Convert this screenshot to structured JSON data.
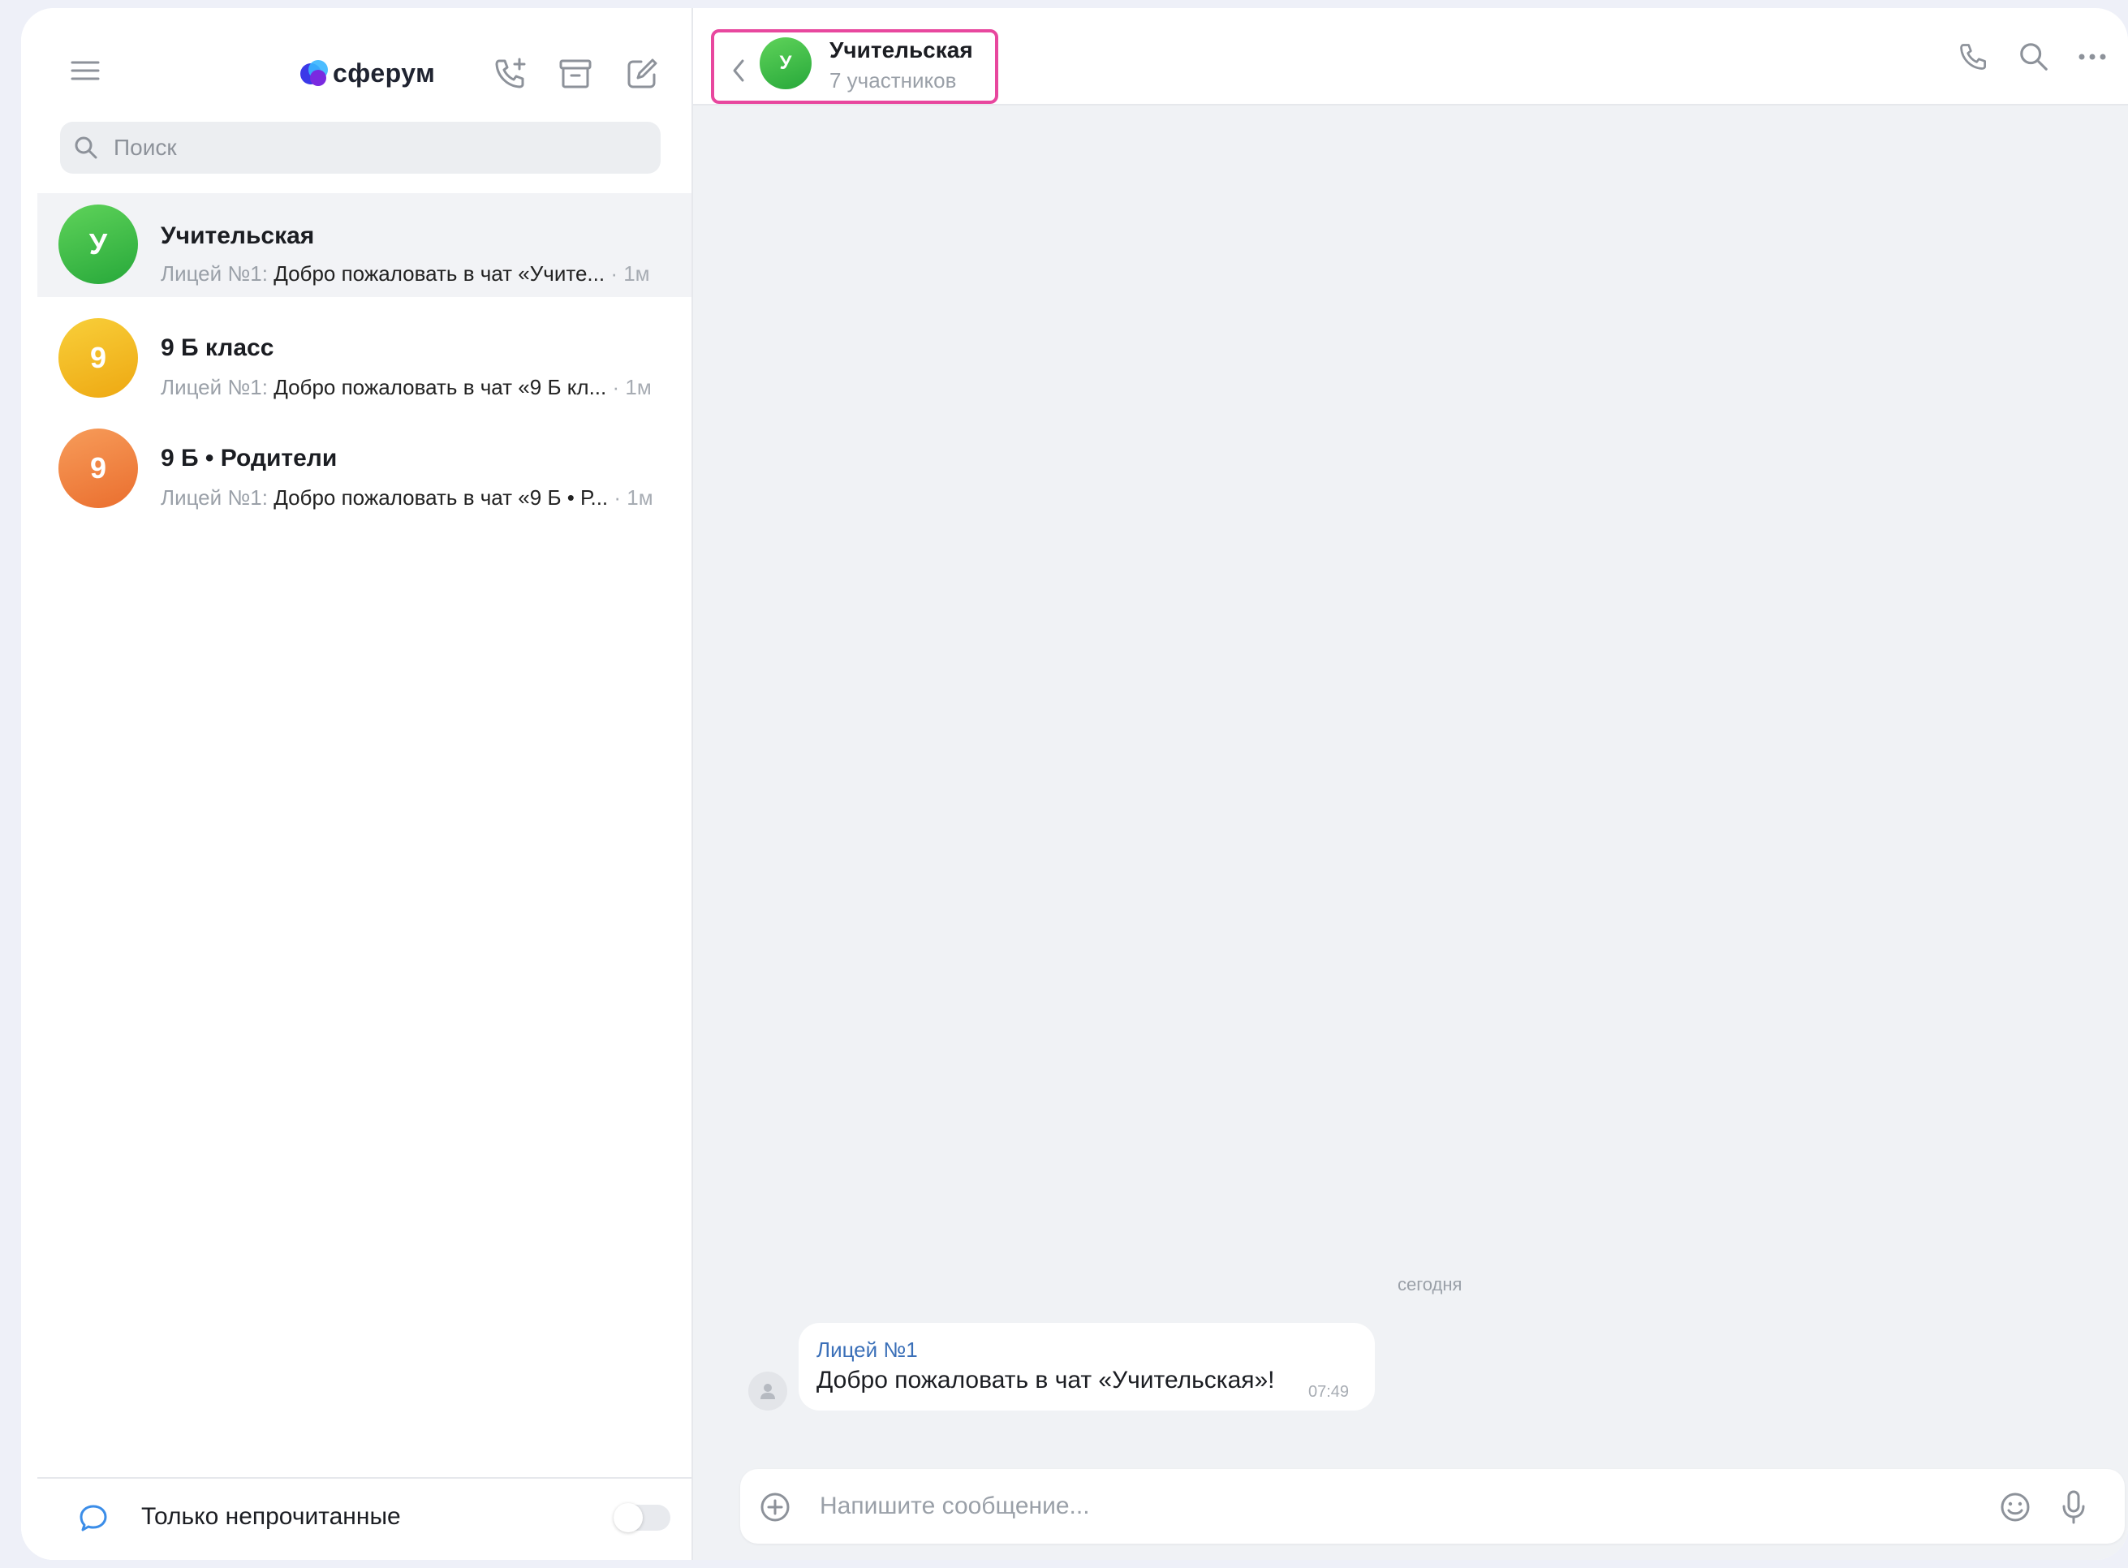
{
  "app": {
    "logo_text": "сферум"
  },
  "sidebar": {
    "search": {
      "placeholder": "Поиск"
    },
    "chats": [
      {
        "name": "Учительская",
        "avatar_letter": "У",
        "avatar_color": "#33b84a",
        "sender": "Лицей №1:",
        "preview": " Добро пожаловать в чат «Учите...",
        "time": " · 1м"
      },
      {
        "name": "9 Б класс",
        "avatar_letter": "9",
        "avatar_color": "#f3b91d",
        "sender": "Лицей №1:",
        "preview": " Добро пожаловать в чат «9 Б кл...",
        "time": " · 1м"
      },
      {
        "name": "9 Б • Родители",
        "avatar_letter": "9",
        "avatar_color": "#f0803f",
        "sender": "Лицей №1:",
        "preview": " Добро пожаловать в чат «9 Б • Р...",
        "time": " · 1м"
      }
    ],
    "footer": {
      "unread_only_label": "Только непрочитанные",
      "toggle_on": false
    }
  },
  "chat": {
    "header": {
      "title": "Учительская",
      "subtitle": "7 участников",
      "avatar_letter": "У"
    },
    "date_separator": "сегодня",
    "messages": [
      {
        "sender": "Лицей №1",
        "text": "Добро пожаловать в чат «Учительская»!",
        "time": "07:49"
      }
    ],
    "composer": {
      "placeholder": "Напишите сообщение..."
    }
  },
  "colors": {
    "accent": "#3a6fb8",
    "highlight": "#e8479e"
  }
}
